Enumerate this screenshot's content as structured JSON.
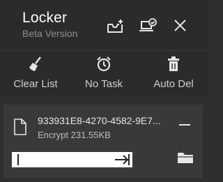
{
  "window": {
    "title": "Locker",
    "subtitle": "Beta Version"
  },
  "header_buttons": {
    "add": {
      "icon": "inbox-add-icon"
    },
    "computer": {
      "icon": "computer-check-icon"
    },
    "close": {
      "icon": "close-icon"
    }
  },
  "toolbar": {
    "clear_list": {
      "label": "Clear List",
      "icon": "broom-icon"
    },
    "no_task": {
      "label": "No Task",
      "icon": "alarm-clock-icon"
    },
    "auto_del": {
      "label": "Auto Del",
      "icon": "trash-icon"
    }
  },
  "task": {
    "file_name": "933931E8-4270-4582-9E7...",
    "status": "Encrypt 231.55KB",
    "file_icon": "document-icon",
    "remove_icon": "minus-icon",
    "arrow_icon": "arrow-right-icon",
    "folder_icon": "folder-icon"
  },
  "colors": {
    "background": "#2f2f2f",
    "header": "#2b2b2b",
    "card": "#393939",
    "text": "#ffffff",
    "muted": "#8f8f8f"
  }
}
